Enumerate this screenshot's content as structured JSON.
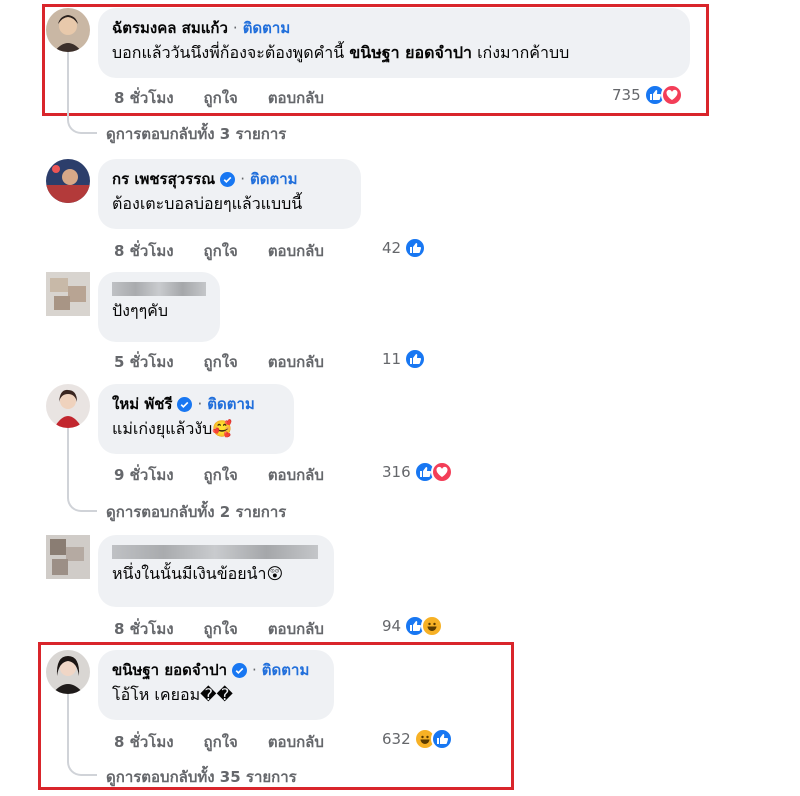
{
  "ui": {
    "follow_label": "ติดตาม",
    "dot": "·",
    "accent": "#216fdb",
    "highlight_color": "#d9252b"
  },
  "comments": [
    {
      "name": "ฉัตรมงคล สมแก้ว",
      "text_pre": "บอกแล้ววันนึงพี่ก้องจะต้องพูดคำนี้ ",
      "text_bold": "ขนิษฐา ยอดจำปา",
      "text_post": " เก่งมากค้าบบ",
      "time": "8 ชั่วโมง",
      "like": "ถูกใจ",
      "reply": "ตอบกลับ",
      "reaction_count": "735",
      "view_replies": "ดูการตอบกลับทั้ง 3 รายการ"
    },
    {
      "name": "กร เพชรสุวรรณ",
      "text": "ต้องเตะบอลบ่อยๆแล้วแบบนี้",
      "time": "8 ชั่วโมง",
      "like": "ถูกใจ",
      "reply": "ตอบกลับ",
      "reaction_count": "42"
    },
    {
      "text": "ปังๆๆคับ",
      "time": "5 ชั่วโมง",
      "like": "ถูกใจ",
      "reply": "ตอบกลับ",
      "reaction_count": "11"
    },
    {
      "name": "ใหม่ พัชรี",
      "text": "แม่เก่งยุแล้วงับ🥰",
      "time": "9 ชั่วโมง",
      "like": "ถูกใจ",
      "reply": "ตอบกลับ",
      "reaction_count": "316",
      "view_replies": "ดูการตอบกลับทั้ง 2 รายการ"
    },
    {
      "text": "หนึ่งในนั้นมีเงินข้อยนำ😲",
      "time": "8 ชั่วโมง",
      "like": "ถูกใจ",
      "reply": "ตอบกลับ",
      "reaction_count": "94"
    },
    {
      "name": "ขนิษฐา ยอดจำปา",
      "text": "โอ้โห เคยอม��",
      "time": "8 ชั่วโมง",
      "like": "ถูกใจ",
      "reply": "ตอบกลับ",
      "reaction_count": "632",
      "view_replies": "ดูการตอบกลับทั้ง 35 รายการ"
    }
  ]
}
